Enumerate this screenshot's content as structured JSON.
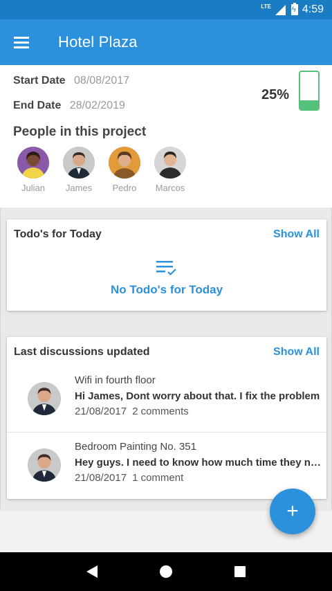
{
  "status_bar": {
    "network": "LTE",
    "time": "4:59"
  },
  "app_bar": {
    "title": "Hotel Plaza",
    "menu_icon": "hamburger-menu-icon"
  },
  "project": {
    "start_label": "Start Date",
    "start_value": "08/08/2017",
    "end_label": "End Date",
    "end_value": "28/02/2019",
    "progress_text": "25%",
    "progress_fraction": 0.25,
    "progress_color": "#55c07a"
  },
  "people": {
    "title": "People in this project",
    "members": [
      {
        "name": "Julian"
      },
      {
        "name": "James"
      },
      {
        "name": "Pedro"
      },
      {
        "name": "Marcos"
      }
    ]
  },
  "todos": {
    "title": "Todo's for Today",
    "show_all": "Show All",
    "empty_icon": "checklist-icon",
    "empty_text": "No Todo's for Today"
  },
  "discussions": {
    "title": "Last discussions updated",
    "show_all": "Show All",
    "items": [
      {
        "topic": "Wifi in fourth floor",
        "message": "Hi James, Dont worry about that. I fix the problem",
        "date": "21/08/2017",
        "comments": "2 comments"
      },
      {
        "topic": "Bedroom Painting No. 351",
        "message": "Hey guys. I need to know how much time they need",
        "date": "21/08/2017",
        "comments": "1 comment"
      }
    ]
  },
  "fab": {
    "icon": "plus-icon",
    "label": "+"
  },
  "colors": {
    "primary": "#2b91dc",
    "status_bar": "#1a7dc3",
    "accent_green": "#55c07a"
  }
}
